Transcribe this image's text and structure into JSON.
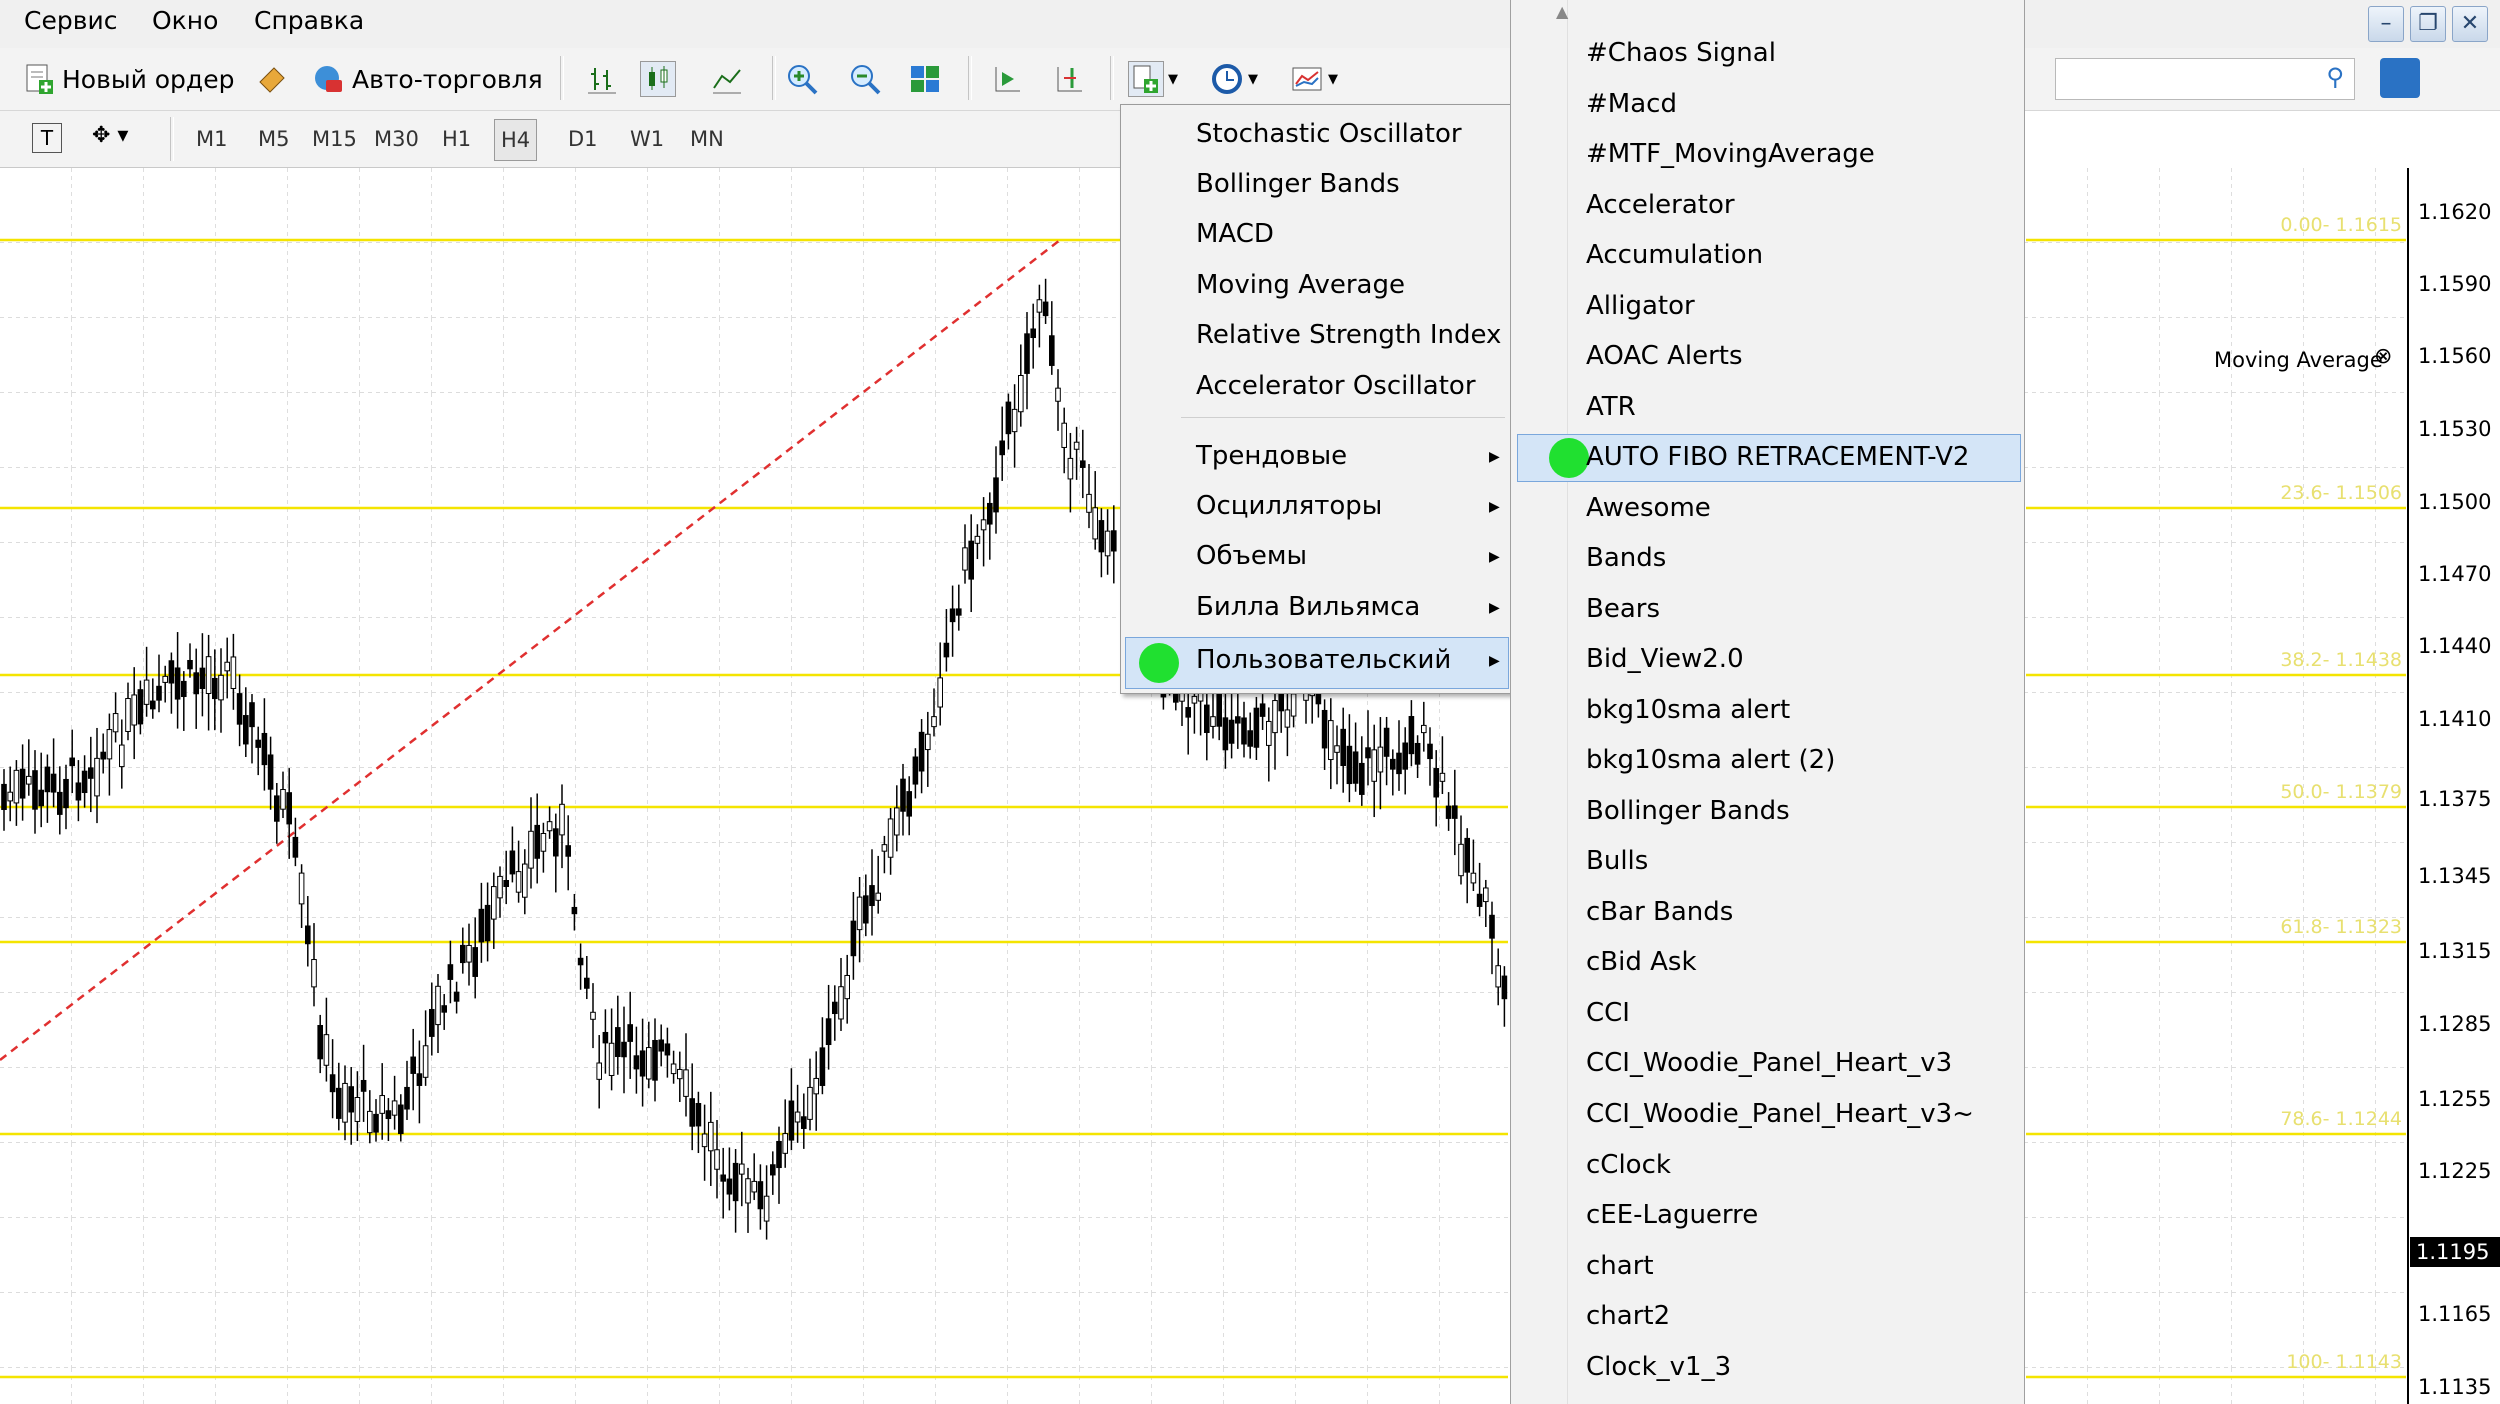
{
  "menubar": {
    "items": [
      "Сервис",
      "Окно",
      "Справка"
    ]
  },
  "toolbar": {
    "new_order": "Новый ордер",
    "auto_trading": "Авто-торговля",
    "timeframes": [
      "M1",
      "M5",
      "M15",
      "M30",
      "H1",
      "H4",
      "D1",
      "W1",
      "MN"
    ],
    "active_timeframe": "H4"
  },
  "chart": {
    "indicator_label": "Moving Average",
    "current_price": "1.1195",
    "price_labels": [
      "1.1620",
      "1.1590",
      "1.1560",
      "1.1530",
      "1.1500",
      "1.1470",
      "1.1440",
      "1.1410",
      "1.1375",
      "1.1345",
      "1.1315",
      "1.1285",
      "1.1255",
      "1.1225",
      "1.1165",
      "1.1135"
    ],
    "fibo_labels": [
      "0.00- 1.1615",
      "23.6- 1.1506",
      "38.2- 1.1438",
      "50.0- 1.1379",
      "61.8- 1.1323",
      "78.6- 1.1244",
      "100- 1.1143"
    ]
  },
  "indicator_menu": {
    "items": [
      "Stochastic Oscillator",
      "Bollinger Bands",
      "MACD",
      "Moving Average",
      "Relative Strength Index",
      "Accelerator Oscillator"
    ],
    "groups": [
      "Трендовые",
      "Осцилляторы",
      "Объемы",
      "Билла Вильямса",
      "Пользовательский"
    ],
    "selected": "Пользовательский"
  },
  "custom_menu": {
    "items": [
      "#Chaos Signal",
      "#Macd",
      "#MTF_MovingAverage",
      "Accelerator",
      "Accumulation",
      "Alligator",
      "AOAC Alerts",
      "ATR",
      "AUTO FIBO RETRACEMENT-V2",
      "Awesome",
      "Bands",
      "Bears",
      "Bid_View2.0",
      "bkg10sma alert",
      "bkg10sma alert (2)",
      "Bollinger Bands",
      "Bulls",
      "cBar Bands",
      "cBid Ask",
      "CCI",
      "CCI_Woodie_Panel_Heart_v3",
      "CCI_Woodie_Panel_Heart_v3~",
      "cClock",
      "cEE-Laguerre",
      "chart",
      "chart2",
      "Clock_v1_3"
    ],
    "selected": "AUTO FIBO RETRACEMENT-V2"
  },
  "colors": {
    "fibo_line": "#f4e400",
    "highlight_dot": "#20e030",
    "selection": "#d4e5f7"
  }
}
